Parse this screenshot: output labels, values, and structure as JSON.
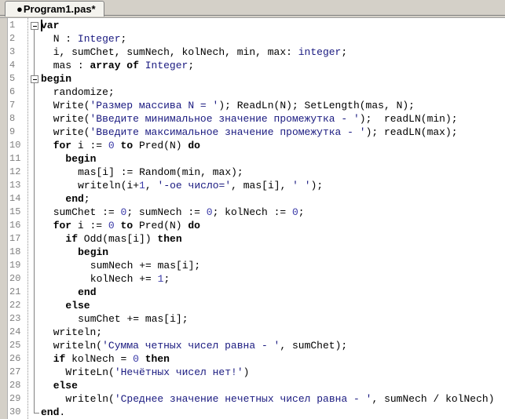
{
  "window": {
    "tab": {
      "modified_dot": "●",
      "label": "Program1.pas*"
    }
  },
  "editor": {
    "language": "pascal",
    "colors": {
      "keyword": "#000000",
      "string": "#1a1a80",
      "number": "#3a3aa8",
      "type": "#1a1a80",
      "line_number": "#808080",
      "gutter": "#d4d0c8"
    },
    "lines": [
      {
        "n": "1",
        "indent": 0,
        "fold": "open",
        "tokens": [
          [
            "kw",
            "var"
          ]
        ]
      },
      {
        "n": "2",
        "indent": 2,
        "tokens": [
          [
            "",
            "N : "
          ],
          [
            "typ",
            "Integer"
          ],
          [
            "",
            ";"
          ]
        ]
      },
      {
        "n": "3",
        "indent": 2,
        "tokens": [
          [
            "",
            "i, sumChet, sumNech, kolNech, min, max: "
          ],
          [
            "typ",
            "integer"
          ],
          [
            "",
            ";"
          ]
        ]
      },
      {
        "n": "4",
        "indent": 2,
        "tokens": [
          [
            "",
            "mas : "
          ],
          [
            "kw",
            "array of"
          ],
          [
            "typ",
            " Integer"
          ],
          [
            "",
            ";"
          ]
        ]
      },
      {
        "n": "5",
        "indent": 0,
        "fold": "open",
        "tokens": [
          [
            "kw",
            "begin"
          ]
        ]
      },
      {
        "n": "6",
        "indent": 2,
        "tokens": [
          [
            "",
            "randomize;"
          ]
        ]
      },
      {
        "n": "7",
        "indent": 2,
        "tokens": [
          [
            "",
            "Write("
          ],
          [
            "str",
            "'Размер массива N = '"
          ],
          [
            "",
            "); ReadLn(N); SetLength(mas, N);"
          ]
        ]
      },
      {
        "n": "8",
        "indent": 2,
        "tokens": [
          [
            "",
            "write("
          ],
          [
            "str",
            "'Введите минимальное значение промежутка - '"
          ],
          [
            "",
            ");  readLN(min);"
          ]
        ]
      },
      {
        "n": "9",
        "indent": 2,
        "tokens": [
          [
            "",
            "write("
          ],
          [
            "str",
            "'Введите максимальное значение промежутка - '"
          ],
          [
            "",
            "); readLN(max);"
          ]
        ]
      },
      {
        "n": "10",
        "indent": 2,
        "tokens": [
          [
            "kw",
            "for"
          ],
          [
            "",
            " i := "
          ],
          [
            "num",
            "0"
          ],
          [
            "",
            " "
          ],
          [
            "kw",
            "to"
          ],
          [
            "",
            " Pred(N) "
          ],
          [
            "kw",
            "do"
          ]
        ]
      },
      {
        "n": "11",
        "indent": 4,
        "tokens": [
          [
            "kw",
            "begin"
          ]
        ]
      },
      {
        "n": "12",
        "indent": 6,
        "tokens": [
          [
            "",
            "mas[i] := Random(min, max);"
          ]
        ]
      },
      {
        "n": "13",
        "indent": 6,
        "tokens": [
          [
            "",
            "writeln(i+"
          ],
          [
            "num",
            "1"
          ],
          [
            "",
            ", "
          ],
          [
            "str",
            "'-ое число='"
          ],
          [
            "",
            ", mas[i], "
          ],
          [
            "str",
            "' '"
          ],
          [
            "",
            ");"
          ]
        ]
      },
      {
        "n": "14",
        "indent": 4,
        "tokens": [
          [
            "kw",
            "end"
          ],
          [
            "",
            ";"
          ]
        ]
      },
      {
        "n": "15",
        "indent": 2,
        "tokens": [
          [
            "",
            "sumChet := "
          ],
          [
            "num",
            "0"
          ],
          [
            "",
            "; sumNech := "
          ],
          [
            "num",
            "0"
          ],
          [
            "",
            "; kolNech := "
          ],
          [
            "num",
            "0"
          ],
          [
            "",
            ";"
          ]
        ]
      },
      {
        "n": "16",
        "indent": 2,
        "tokens": [
          [
            "kw",
            "for"
          ],
          [
            "",
            " i := "
          ],
          [
            "num",
            "0"
          ],
          [
            "",
            " "
          ],
          [
            "kw",
            "to"
          ],
          [
            "",
            " Pred(N) "
          ],
          [
            "kw",
            "do"
          ]
        ]
      },
      {
        "n": "17",
        "indent": 4,
        "tokens": [
          [
            "kw",
            "if"
          ],
          [
            "",
            " Odd(mas[i]) "
          ],
          [
            "kw",
            "then"
          ]
        ]
      },
      {
        "n": "18",
        "indent": 6,
        "tokens": [
          [
            "kw",
            "begin"
          ]
        ]
      },
      {
        "n": "19",
        "indent": 8,
        "tokens": [
          [
            "",
            "sumNech += mas[i];"
          ]
        ]
      },
      {
        "n": "20",
        "indent": 8,
        "tokens": [
          [
            "",
            "kolNech += "
          ],
          [
            "num",
            "1"
          ],
          [
            "",
            ";"
          ]
        ]
      },
      {
        "n": "21",
        "indent": 6,
        "tokens": [
          [
            "kw",
            "end"
          ]
        ]
      },
      {
        "n": "22",
        "indent": 4,
        "tokens": [
          [
            "kw",
            "else"
          ]
        ]
      },
      {
        "n": "23",
        "indent": 6,
        "tokens": [
          [
            "",
            "sumChet += mas[i];"
          ]
        ]
      },
      {
        "n": "24",
        "indent": 2,
        "tokens": [
          [
            "",
            "writeln;"
          ]
        ]
      },
      {
        "n": "25",
        "indent": 2,
        "tokens": [
          [
            "",
            "writeln("
          ],
          [
            "str",
            "'Сумма четных чисел равна - '"
          ],
          [
            "",
            ", sumChet);"
          ]
        ]
      },
      {
        "n": "26",
        "indent": 2,
        "tokens": [
          [
            "kw",
            "if"
          ],
          [
            "",
            " kolNech = "
          ],
          [
            "num",
            "0"
          ],
          [
            "",
            " "
          ],
          [
            "kw",
            "then"
          ]
        ]
      },
      {
        "n": "27",
        "indent": 4,
        "tokens": [
          [
            "",
            "WriteLn("
          ],
          [
            "str",
            "'Нечётных чисел нет!'"
          ],
          [
            "",
            ")"
          ]
        ]
      },
      {
        "n": "28",
        "indent": 2,
        "tokens": [
          [
            "kw",
            "else"
          ]
        ]
      },
      {
        "n": "29",
        "indent": 4,
        "tokens": [
          [
            "",
            "writeln("
          ],
          [
            "str",
            "'Среднее значение нечетных чисел равна - '"
          ],
          [
            "",
            ", sumNech / kolNech)"
          ]
        ]
      },
      {
        "n": "30",
        "indent": 0,
        "fold": "end",
        "tokens": [
          [
            "kw",
            "end"
          ],
          [
            "",
            "."
          ]
        ]
      }
    ]
  }
}
